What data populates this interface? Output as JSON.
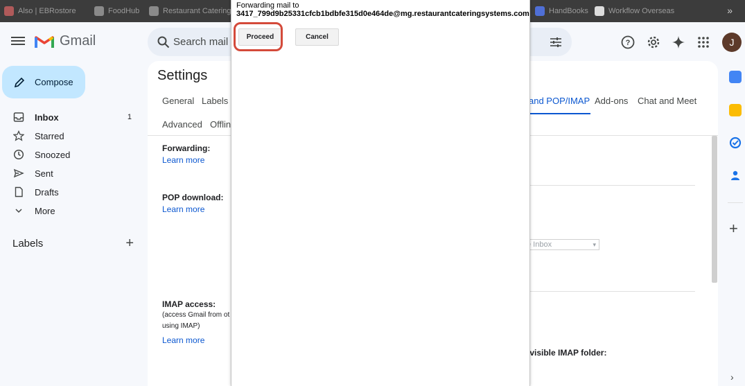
{
  "browser": {
    "bookmarks": [
      "Also | EBRostore",
      "FoodHub",
      "Restaurant Catering...",
      "",
      "",
      "",
      "HandBooks",
      "Workflow Overseas"
    ],
    "overflow_icon": "chevron-double-right-icon"
  },
  "header": {
    "app_name": "Gmail",
    "search_placeholder": "Search mail",
    "avatar_letter": "J"
  },
  "nav": {
    "compose_label": "Compose",
    "items": [
      {
        "label": "Inbox",
        "count": "1",
        "icon": "inbox-icon"
      },
      {
        "label": "Starred",
        "count": "",
        "icon": "star-icon"
      },
      {
        "label": "Snoozed",
        "count": "",
        "icon": "clock-icon"
      },
      {
        "label": "Sent",
        "count": "",
        "icon": "send-icon"
      },
      {
        "label": "Drafts",
        "count": "",
        "icon": "draft-icon"
      },
      {
        "label": "More",
        "count": "",
        "icon": "chevron-down-icon"
      }
    ],
    "labels_heading": "Labels"
  },
  "settings": {
    "title": "Settings",
    "tabs": [
      "General",
      "Labels",
      "and POP/IMAP",
      "Add-ons",
      "Chat and Meet",
      "Advanced",
      "Offlin"
    ],
    "active_tab": "and POP/IMAP",
    "forwarding_title": "Forwarding:",
    "pop_title": "POP download:",
    "imap_title": "IMAP access:",
    "imap_note_1": "(access Gmail from ot",
    "imap_note_2": "using IMAP)",
    "learn_more": "Learn more",
    "select_fragment": "e Inbox",
    "imap_folder_fragment": "t visible IMAP folder:"
  },
  "dialog": {
    "line1": "Forwarding mail to",
    "line2": "3417_799d9b25331cfcb1bdbfe315d0e464de@mg.restaurantcateringsystems.com",
    "proceed_label": "Proceed",
    "cancel_label": "Cancel"
  },
  "colors": {
    "accent": "#0b57d0",
    "compose_bg": "#c2e7ff",
    "highlight": "#d44a3a"
  }
}
